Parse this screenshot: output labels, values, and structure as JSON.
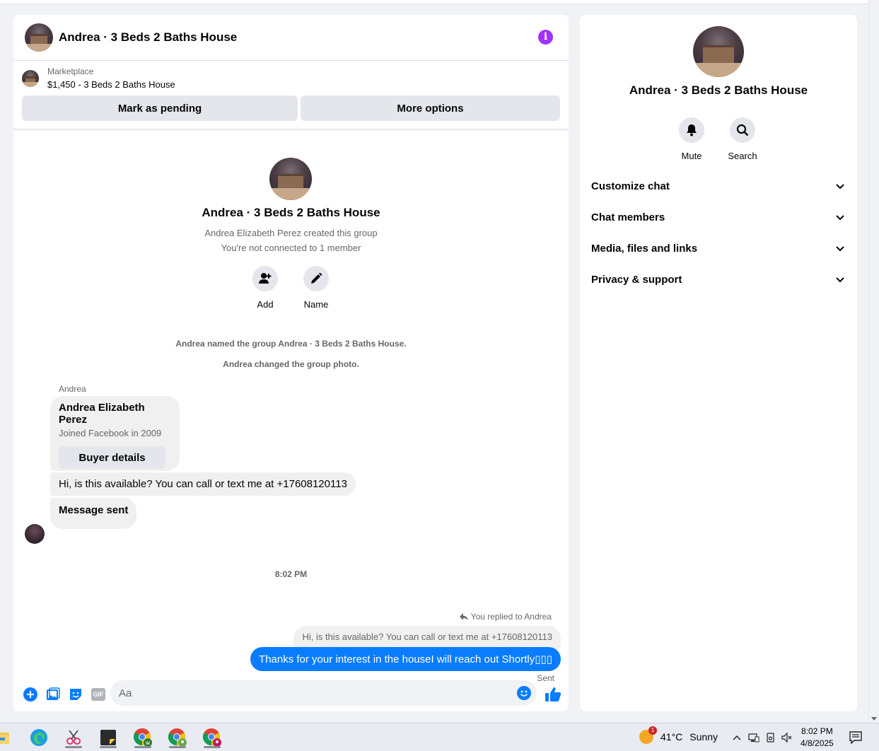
{
  "chat": {
    "title": "Andrea · 3 Beds 2 Baths House",
    "marketplace_label": "Marketplace",
    "listing": "$1,450 - 3 Beds 2 Baths House",
    "mark_pending": "Mark as pending",
    "more_options": "More options",
    "intro": {
      "title": "Andrea · 3 Beds 2 Baths House",
      "created": "Andrea Elizabeth Perez created this group",
      "connected": "You're not connected to 1 member",
      "add_label": "Add",
      "name_label": "Name"
    },
    "system_messages": [
      "Andrea named the group Andrea · 3 Beds 2 Baths House.",
      "Andrea changed the group photo."
    ],
    "sender": "Andrea",
    "buyer_card": {
      "name": "Andrea Elizabeth Perez",
      "joined": "Joined Facebook in 2009",
      "button": "Buyer details"
    },
    "incoming": [
      "Hi, is this available? You can call or text me at +17608120113",
      "Message sent"
    ],
    "timestamp": "8:02 PM",
    "replied_to": "You replied to Andrea",
    "quoted": "Hi, is this available? You can call or text me at +17608120113",
    "outgoing": "Thanks for your interest in the houseI will reach out Shortly",
    "status": "Sent",
    "composer_placeholder": "Aa",
    "gif_label": "GIF"
  },
  "side": {
    "title": "Andrea · 3 Beds 2 Baths House",
    "mute_label": "Mute",
    "search_label": "Search",
    "sections": [
      "Customize chat",
      "Chat members",
      "Media, files and links",
      "Privacy & support"
    ]
  },
  "taskbar": {
    "apps": [
      "file-explorer",
      "edge",
      "snipping-tool",
      "sticky-notes",
      "chrome-w",
      "chrome-profile-2",
      "chrome-profile-3"
    ],
    "weather_badge": "1",
    "weather_temp": "41°C",
    "weather_condition": "Sunny",
    "time": "8:02 PM",
    "date": "4/8/2025"
  },
  "colors": {
    "accent_blue": "#0a7cff",
    "info_purple": "#a033ff",
    "bubble_grey": "#f0f0f0",
    "page_bg": "#f0f2f5"
  }
}
